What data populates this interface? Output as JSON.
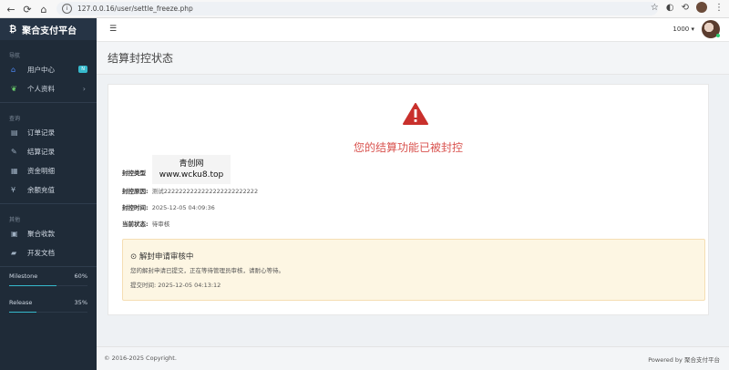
{
  "browser": {
    "url": "127.0.0.16/user/settle_freeze.php"
  },
  "sidebar": {
    "brand": "聚合支付平台",
    "sections": [
      {
        "title": "导航"
      },
      {
        "title": "查询"
      },
      {
        "title": "其他"
      }
    ],
    "items": [
      {
        "label": "用户中心",
        "badge": "N"
      },
      {
        "label": "个人资料"
      },
      {
        "label": "订单记录"
      },
      {
        "label": "结算记录"
      },
      {
        "label": "资金明细"
      },
      {
        "label": "余额充值"
      },
      {
        "label": "聚合收款"
      },
      {
        "label": "开发文档"
      }
    ],
    "progress": [
      {
        "label": "Milestone",
        "percent_text": "60%",
        "value": 0.6
      },
      {
        "label": "Release",
        "percent_text": "35%",
        "value": 0.35
      }
    ]
  },
  "header": {
    "user_number": "1000",
    "page_title": "结算封控状态"
  },
  "main": {
    "headline": "您的结算功能已被封控",
    "fields": [
      {
        "label": "封控类型",
        "value": ""
      },
      {
        "label": "封控原因:",
        "value": "测试2222222222222222222222222"
      },
      {
        "label": "封控时间:",
        "value": "2025-12-05 04:09:36"
      },
      {
        "label": "当前状态:",
        "value": "待审核"
      }
    ],
    "watermark": {
      "line1": "青创网",
      "line2": "www.wcku8.top"
    },
    "notice": {
      "title": "解封申请审核中",
      "text": "您的解封申请已提交，正在等待管理员审核，请耐心等待。",
      "time_label": "提交时间:",
      "time_value": "2025-12-05 04:13:12"
    }
  },
  "footer": {
    "copyright": "© 2016-2025 Copyright.",
    "powered_prefix": "Powered by",
    "powered_name": "聚合支付平台"
  },
  "colors": {
    "sidebar_bg": "#1f2b38",
    "danger": "#d9534f",
    "warning": "#f0ad4e",
    "info": "#36b9cc"
  }
}
